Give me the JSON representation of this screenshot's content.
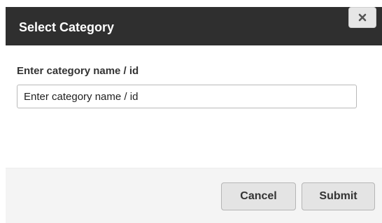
{
  "dialog": {
    "title": "Select Category",
    "close_icon": "close-icon"
  },
  "form": {
    "label": "Enter category name / id",
    "input_value": "",
    "input_placeholder": "Enter category name / id"
  },
  "footer": {
    "cancel_label": "Cancel",
    "submit_label": "Submit"
  },
  "colors": {
    "header_bg": "#2f2f2f",
    "header_text": "#ffffff",
    "footer_bg": "#f4f4f4",
    "button_bg": "#e4e4e4"
  }
}
